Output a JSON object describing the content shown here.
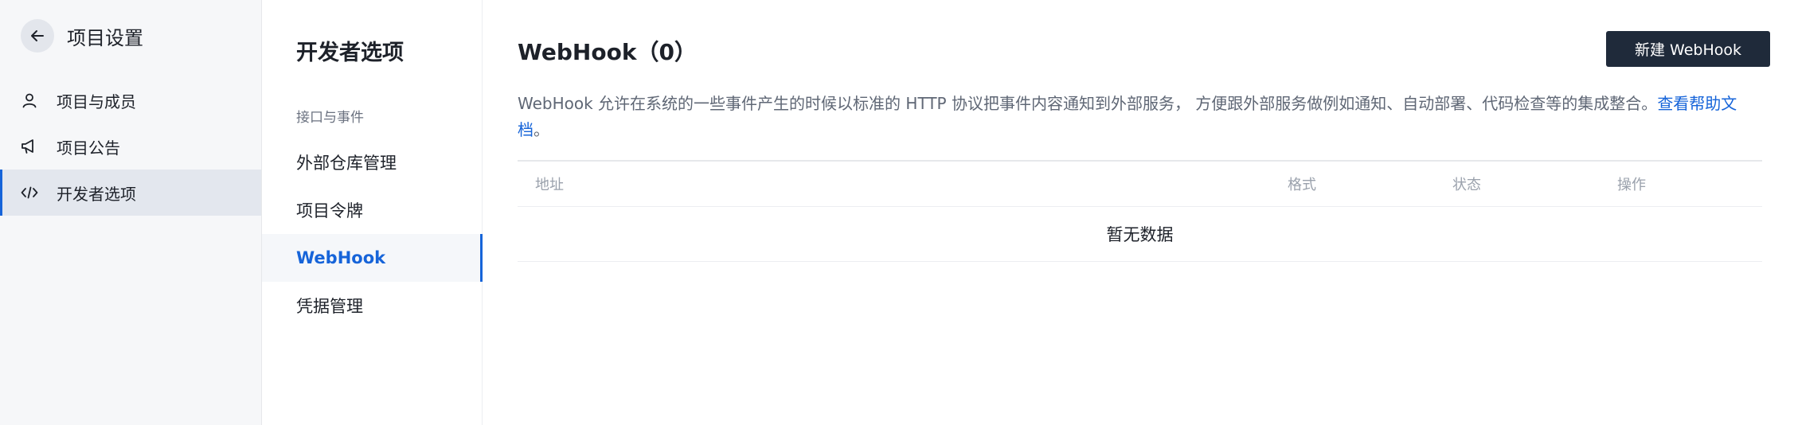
{
  "sidebar": {
    "title": "项目设置",
    "items": [
      {
        "label": "项目与成员",
        "icon": "user-icon",
        "active": false
      },
      {
        "label": "项目公告",
        "icon": "megaphone-icon",
        "active": false
      },
      {
        "label": "开发者选项",
        "icon": "code-icon",
        "active": true
      }
    ]
  },
  "subnav": {
    "title": "开发者选项",
    "group_label": "接口与事件",
    "items": [
      {
        "label": "外部仓库管理",
        "active": false
      },
      {
        "label": "项目令牌",
        "active": false
      },
      {
        "label": "WebHook",
        "active": true
      },
      {
        "label": "凭据管理",
        "active": false
      }
    ]
  },
  "main": {
    "title": "WebHook（0）",
    "new_button_label": "新建 WebHook",
    "description": "WebHook 允许在系统的一些事件产生的时候以标准的 HTTP 协议把事件内容通知到外部服务， 方便跟外部服务做例如通知、自动部署、代码检查等的集成整合。",
    "help_link": "查看帮助文档",
    "description_end": "。",
    "table": {
      "columns": [
        "地址",
        "格式",
        "状态",
        "操作"
      ],
      "empty_text": "暂无数据"
    }
  },
  "colors": {
    "accent": "#1664d9",
    "button_dark": "#1f2a3a",
    "sidebar_bg": "#f6f7f9"
  }
}
